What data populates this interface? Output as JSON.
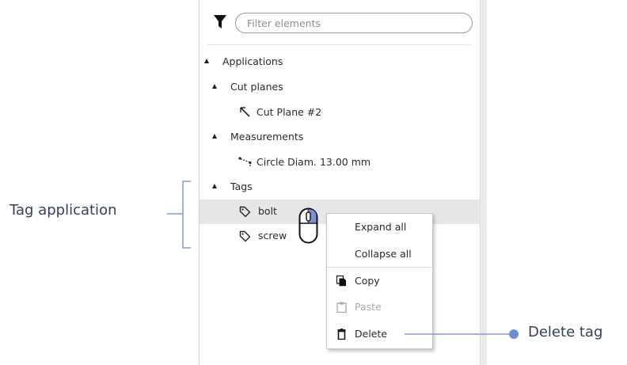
{
  "filter": {
    "placeholder": "Filter elements",
    "value": ""
  },
  "tree": {
    "applications": "Applications",
    "cut_planes": "Cut planes",
    "cut_plane_item": "Cut Plane #2",
    "measurements": "Measurements",
    "measurement_item": "Circle  Diam. 13.00 mm",
    "tags": "Tags",
    "tag_items": [
      "bolt",
      "screw"
    ]
  },
  "context_menu": {
    "expand_all": "Expand all",
    "collapse_all": "Collapse all",
    "copy": "Copy",
    "paste": "Paste",
    "delete": "Delete",
    "paste_disabled": true
  },
  "annotations": {
    "left": "Tag application",
    "right": "Delete tag"
  },
  "colors": {
    "annotation_text": "#33405a",
    "annotation_line": "#7e9bd8",
    "annotation_dot": "#6f8dd4",
    "selected_row": "#e6e6e6",
    "mouse_button_highlight": "#7b93d6"
  },
  "icons": {
    "filter": "funnel-icon",
    "cut_plane": "cut-plane-icon",
    "measurement": "measure-icon",
    "tag": "tag-icon",
    "copy": "copy-icon",
    "paste": "clipboard-icon",
    "delete": "trash-icon",
    "cursor": "mouse-right-click-icon"
  }
}
